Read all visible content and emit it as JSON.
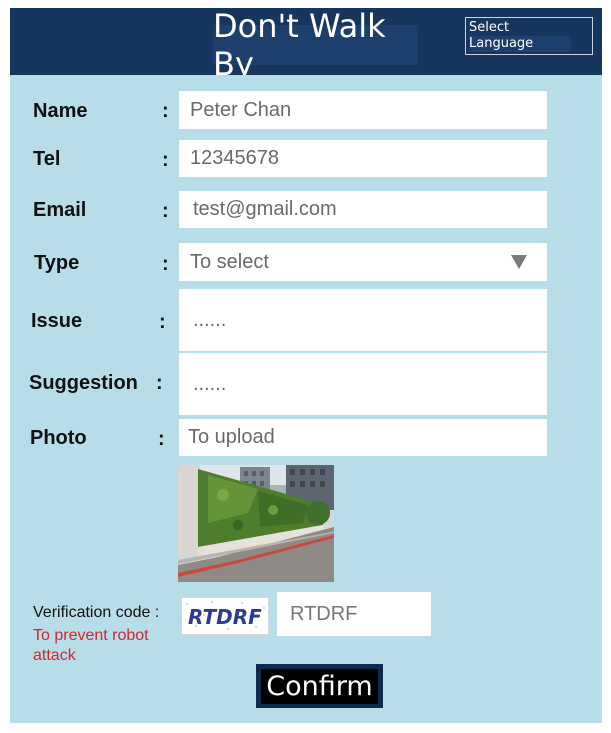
{
  "header": {
    "title": "Don't Walk By",
    "language_line1": "Select",
    "language_line2": "Language"
  },
  "form": {
    "name": {
      "label": "Name",
      "colon": ":",
      "value": "Peter Chan"
    },
    "tel": {
      "label": "Tel",
      "colon": ":",
      "value": "12345678"
    },
    "email": {
      "label": "Email",
      "colon": ":",
      "value": "test@gmail.com"
    },
    "type": {
      "label": "Type",
      "colon": ":",
      "value": "To select"
    },
    "issue": {
      "label": "Issue",
      "colon": ":",
      "value": "......"
    },
    "suggestion": {
      "label": "Suggestion",
      "colon": ":",
      "value": "......"
    },
    "photo": {
      "label": "Photo",
      "colon": ":",
      "value": "To upload"
    }
  },
  "verification": {
    "label": "Verification code :",
    "note": "To prevent robot attack",
    "captcha_text": "RTDRF",
    "input_value": "RTDRF"
  },
  "confirm_label": "Confirm",
  "colors": {
    "header_bg": "#17365d",
    "panel_bg": "#b7dde8",
    "note_red": "#d2262b"
  }
}
